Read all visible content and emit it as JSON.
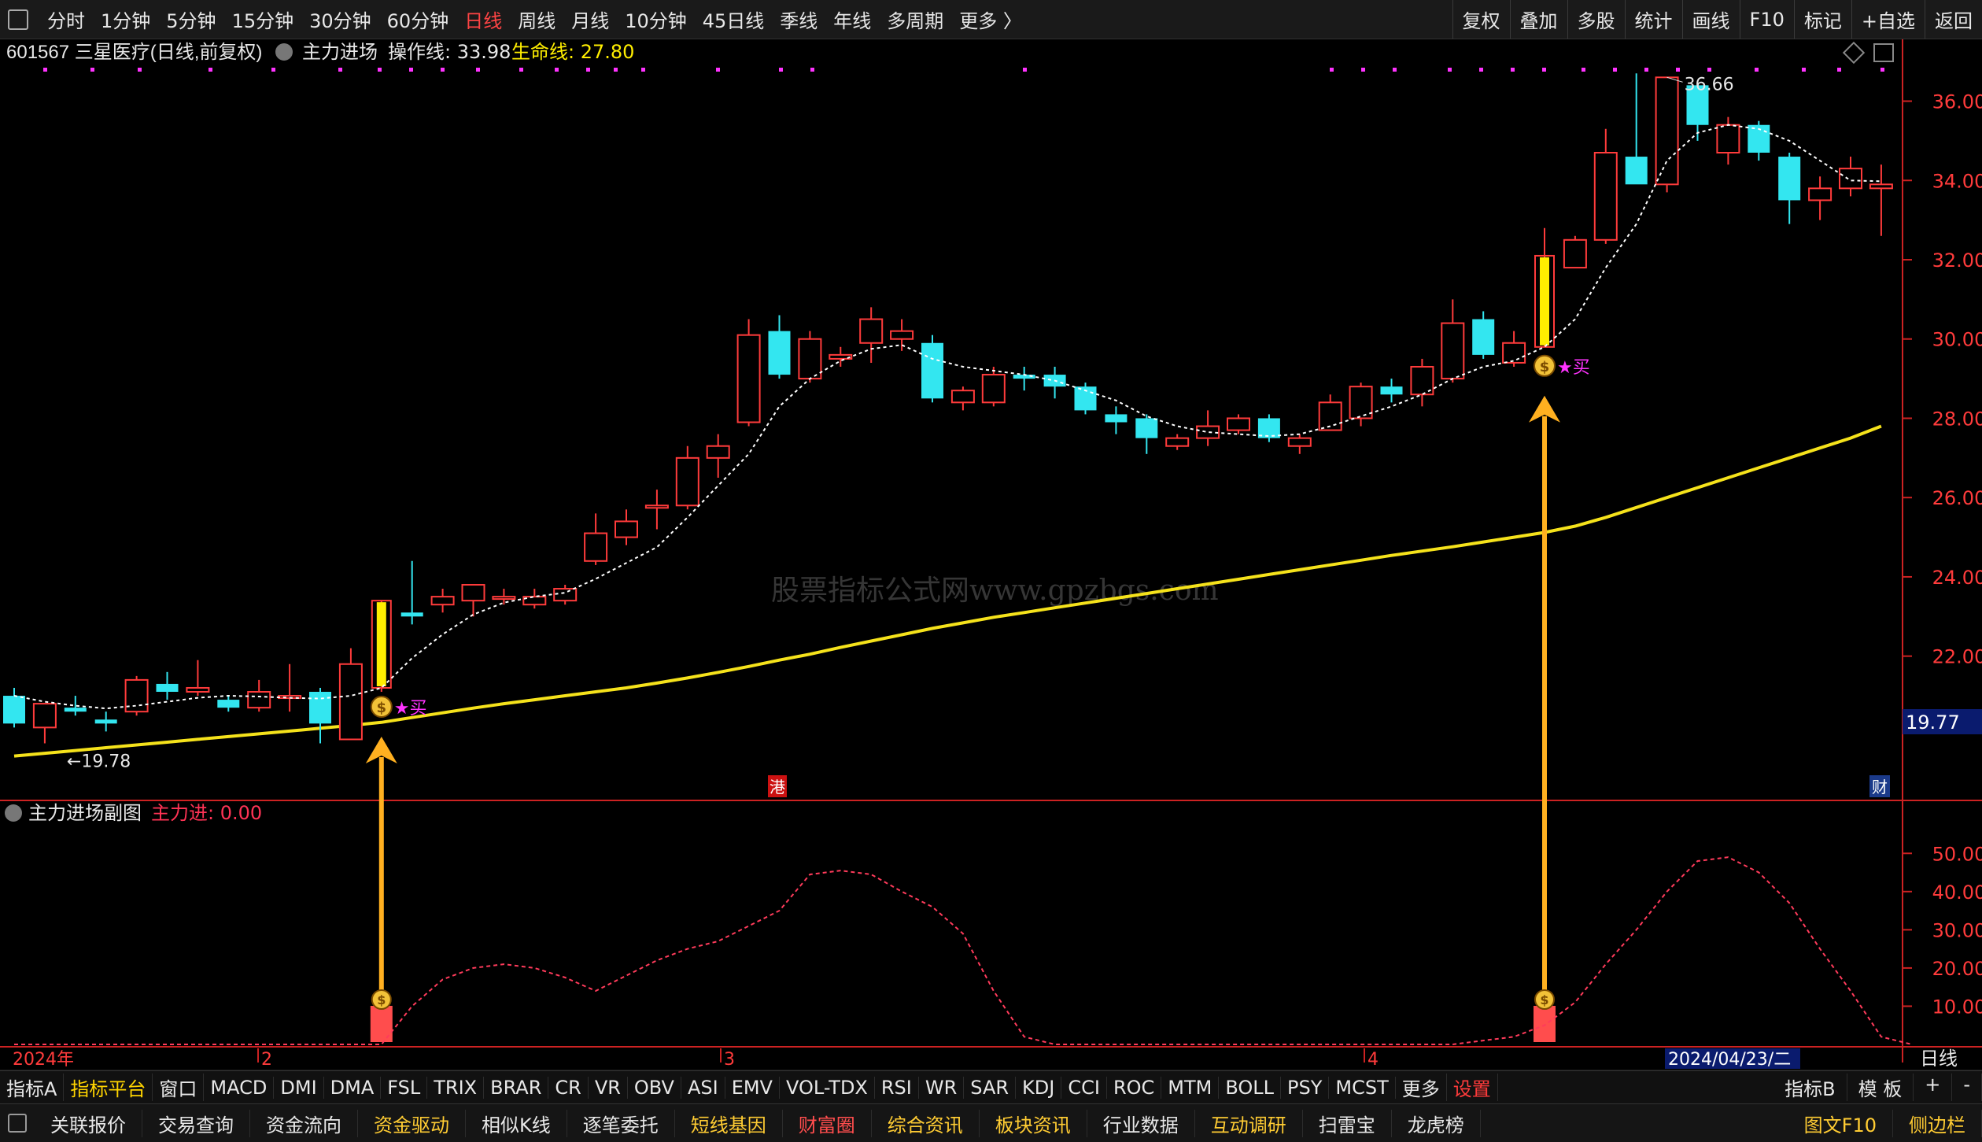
{
  "topbar": {
    "periods": [
      {
        "label": "分时",
        "active": false
      },
      {
        "label": "1分钟",
        "active": false
      },
      {
        "label": "5分钟",
        "active": false
      },
      {
        "label": "15分钟",
        "active": false
      },
      {
        "label": "30分钟",
        "active": false
      },
      {
        "label": "60分钟",
        "active": false
      },
      {
        "label": "日线",
        "active": true
      },
      {
        "label": "周线",
        "active": false
      },
      {
        "label": "月线",
        "active": false
      },
      {
        "label": "10分钟",
        "active": false
      },
      {
        "label": "45日线",
        "active": false
      },
      {
        "label": "季线",
        "active": false
      },
      {
        "label": "年线",
        "active": false
      },
      {
        "label": "多周期",
        "active": false
      },
      {
        "label": "更多 〉",
        "active": false
      }
    ],
    "right_buttons": [
      "复权",
      "叠加",
      "多股",
      "统计",
      "画线",
      "F10",
      "标记",
      "+自选",
      "返回"
    ]
  },
  "main_panel": {
    "stock_label": "601567 三星医疗(日线,前复权)",
    "indicator_name": "主力进场",
    "op_line_label": "操作线: 33.98",
    "life_line_label": "生命线: 27.80",
    "watermark": "股票指标公式网www.gpzbgs.com",
    "price_tag": "19.77",
    "low_label": "←19.78",
    "high_label": "36.66",
    "badge_gang": "港",
    "badge_cai": "财",
    "buy_label": "★买",
    "colors": {
      "up": "#ff3b3b",
      "down": "#33e6f0",
      "signal": "#ffee00",
      "life": "#f5e21b",
      "axis": "#cc2222",
      "arrow": "#ffb020",
      "magenta": "#ff33ff"
    }
  },
  "sub_panel": {
    "title": "主力进场副图",
    "value_label": "主力进: 0.00"
  },
  "x_labels": {
    "year": "2024年",
    "m2": "2",
    "m3": "3",
    "m4": "4",
    "cursor_date": "2024/04/23/二",
    "period": "日线"
  },
  "bottom_tabs": [
    "指标A",
    "指标平台",
    "窗口",
    "MACD",
    "DMI",
    "DMA",
    "FSL",
    "TRIX",
    "BRAR",
    "CR",
    "VR",
    "OBV",
    "ASI",
    "EMV",
    "VOL-TDX",
    "RSI",
    "WR",
    "SAR",
    "KDJ",
    "CCI",
    "ROC",
    "MTM",
    "BOLL",
    "PSY",
    "MCST",
    "更多",
    "设置"
  ],
  "bottom_right_tabs": [
    "指标B",
    "模 板",
    "+",
    "-"
  ],
  "bottom_buttons": [
    {
      "label": "关联报价",
      "style": ""
    },
    {
      "label": "交易查询",
      "style": ""
    },
    {
      "label": "资金流向",
      "style": ""
    },
    {
      "label": "资金驱动",
      "style": "y"
    },
    {
      "label": "相似K线",
      "style": ""
    },
    {
      "label": "逐笔委托",
      "style": ""
    },
    {
      "label": "短线基因",
      "style": "y"
    },
    {
      "label": "财富圈",
      "style": "r"
    },
    {
      "label": "综合资讯",
      "style": "y"
    },
    {
      "label": "板块资讯",
      "style": "y"
    },
    {
      "label": "行业数据",
      "style": ""
    },
    {
      "label": "互动调研",
      "style": "y"
    },
    {
      "label": "扫雷宝",
      "style": ""
    },
    {
      "label": "龙虎榜",
      "style": ""
    }
  ],
  "bottom_right_buttons": [
    "图文F10",
    "侧边栏"
  ],
  "chart_data": {
    "type": "candlestick",
    "y_axis": {
      "ticks": [
        "36.00",
        "34.00",
        "32.00",
        "30.00",
        "28.00",
        "26.00",
        "24.00",
        "22.00"
      ],
      "ylim": [
        18.4,
        37.4
      ]
    },
    "sub_y_axis": {
      "ticks": [
        "50.00",
        "40.00",
        "30.00",
        "20.00",
        "10.00"
      ],
      "ylim": [
        0,
        55
      ]
    },
    "candles": [
      {
        "o": 21.0,
        "h": 21.2,
        "l": 20.2,
        "c": 20.3
      },
      {
        "o": 20.2,
        "h": 20.8,
        "l": 19.8,
        "c": 20.8
      },
      {
        "o": 20.7,
        "h": 21.0,
        "l": 20.5,
        "c": 20.6
      },
      {
        "o": 20.4,
        "h": 20.6,
        "l": 20.1,
        "c": 20.3
      },
      {
        "o": 20.6,
        "h": 21.5,
        "l": 20.5,
        "c": 21.4
      },
      {
        "o": 21.3,
        "h": 21.6,
        "l": 20.9,
        "c": 21.1
      },
      {
        "o": 21.1,
        "h": 21.9,
        "l": 21.0,
        "c": 21.2
      },
      {
        "o": 20.9,
        "h": 21.0,
        "l": 20.6,
        "c": 20.7
      },
      {
        "o": 20.7,
        "h": 21.4,
        "l": 20.6,
        "c": 21.1
      },
      {
        "o": 21.0,
        "h": 21.8,
        "l": 20.6,
        "c": 21.0
      },
      {
        "o": 21.1,
        "h": 21.2,
        "l": 19.8,
        "c": 20.3
      },
      {
        "o": 19.9,
        "h": 22.2,
        "l": 19.9,
        "c": 21.8
      },
      {
        "o": 21.2,
        "h": 23.4,
        "l": 21.1,
        "c": 23.4,
        "signal": true
      },
      {
        "o": 23.1,
        "h": 24.4,
        "l": 22.8,
        "c": 23.0
      },
      {
        "o": 23.3,
        "h": 23.7,
        "l": 23.1,
        "c": 23.5
      },
      {
        "o": 23.4,
        "h": 23.8,
        "l": 23.0,
        "c": 23.8
      },
      {
        "o": 23.5,
        "h": 23.7,
        "l": 23.3,
        "c": 23.5
      },
      {
        "o": 23.3,
        "h": 23.7,
        "l": 23.2,
        "c": 23.5
      },
      {
        "o": 23.4,
        "h": 23.8,
        "l": 23.3,
        "c": 23.7
      },
      {
        "o": 24.4,
        "h": 25.6,
        "l": 24.3,
        "c": 25.1
      },
      {
        "o": 25.0,
        "h": 25.7,
        "l": 24.8,
        "c": 25.4
      },
      {
        "o": 25.8,
        "h": 26.2,
        "l": 25.2,
        "c": 25.8
      },
      {
        "o": 25.8,
        "h": 27.3,
        "l": 25.7,
        "c": 27.0
      },
      {
        "o": 27.0,
        "h": 27.6,
        "l": 26.5,
        "c": 27.3
      },
      {
        "o": 27.9,
        "h": 30.5,
        "l": 27.8,
        "c": 30.1
      },
      {
        "o": 30.2,
        "h": 30.6,
        "l": 29.0,
        "c": 29.1
      },
      {
        "o": 29.0,
        "h": 30.2,
        "l": 28.9,
        "c": 30.0
      },
      {
        "o": 29.5,
        "h": 29.8,
        "l": 29.3,
        "c": 29.6
      },
      {
        "o": 29.9,
        "h": 30.8,
        "l": 29.4,
        "c": 30.5
      },
      {
        "o": 30.0,
        "h": 30.5,
        "l": 29.7,
        "c": 30.2
      },
      {
        "o": 29.9,
        "h": 30.1,
        "l": 28.4,
        "c": 28.5
      },
      {
        "o": 28.4,
        "h": 28.8,
        "l": 28.2,
        "c": 28.7
      },
      {
        "o": 28.4,
        "h": 29.3,
        "l": 28.3,
        "c": 29.1
      },
      {
        "o": 29.1,
        "h": 29.3,
        "l": 28.7,
        "c": 29.0
      },
      {
        "o": 29.1,
        "h": 29.3,
        "l": 28.5,
        "c": 28.8
      },
      {
        "o": 28.8,
        "h": 28.9,
        "l": 28.1,
        "c": 28.2
      },
      {
        "o": 28.1,
        "h": 28.3,
        "l": 27.6,
        "c": 27.9
      },
      {
        "o": 28.0,
        "h": 28.1,
        "l": 27.1,
        "c": 27.5
      },
      {
        "o": 27.3,
        "h": 27.6,
        "l": 27.2,
        "c": 27.5
      },
      {
        "o": 27.5,
        "h": 28.2,
        "l": 27.3,
        "c": 27.8
      },
      {
        "o": 27.7,
        "h": 28.1,
        "l": 27.6,
        "c": 28.0
      },
      {
        "o": 28.0,
        "h": 28.1,
        "l": 27.4,
        "c": 27.5
      },
      {
        "o": 27.3,
        "h": 27.6,
        "l": 27.1,
        "c": 27.5
      },
      {
        "o": 27.7,
        "h": 28.6,
        "l": 27.7,
        "c": 28.4
      },
      {
        "o": 28.0,
        "h": 28.9,
        "l": 27.8,
        "c": 28.8
      },
      {
        "o": 28.8,
        "h": 29.0,
        "l": 28.4,
        "c": 28.6
      },
      {
        "o": 28.6,
        "h": 29.5,
        "l": 28.3,
        "c": 29.3
      },
      {
        "o": 29.0,
        "h": 31.0,
        "l": 28.9,
        "c": 30.4
      },
      {
        "o": 30.5,
        "h": 30.7,
        "l": 29.5,
        "c": 29.6
      },
      {
        "o": 29.4,
        "h": 30.2,
        "l": 29.3,
        "c": 29.9
      },
      {
        "o": 29.8,
        "h": 32.8,
        "l": 29.8,
        "c": 32.1,
        "signal": true
      },
      {
        "o": 31.8,
        "h": 32.6,
        "l": 31.8,
        "c": 32.5
      },
      {
        "o": 32.5,
        "h": 35.3,
        "l": 32.4,
        "c": 34.7
      },
      {
        "o": 34.6,
        "h": 36.7,
        "l": 34.1,
        "c": 33.9
      },
      {
        "o": 33.9,
        "h": 36.6,
        "l": 33.7,
        "c": 36.6
      },
      {
        "o": 36.4,
        "h": 36.5,
        "l": 35.0,
        "c": 35.4
      },
      {
        "o": 34.7,
        "h": 35.6,
        "l": 34.4,
        "c": 35.4
      },
      {
        "o": 35.4,
        "h": 35.5,
        "l": 34.5,
        "c": 34.7
      },
      {
        "o": 34.6,
        "h": 34.7,
        "l": 32.9,
        "c": 33.5
      },
      {
        "o": 33.5,
        "h": 34.1,
        "l": 33.0,
        "c": 33.8
      },
      {
        "o": 33.8,
        "h": 34.6,
        "l": 33.6,
        "c": 34.3
      },
      {
        "o": 33.8,
        "h": 34.4,
        "l": 32.6,
        "c": 33.9
      }
    ],
    "op_line": [
      21.0,
      20.85,
      20.75,
      20.68,
      20.75,
      20.85,
      20.95,
      21.0,
      20.98,
      20.95,
      20.93,
      21.0,
      21.2,
      21.95,
      22.55,
      23.05,
      23.35,
      23.5,
      23.6,
      23.95,
      24.35,
      24.75,
      25.5,
      26.3,
      27.1,
      28.3,
      29.0,
      29.45,
      29.75,
      29.85,
      29.5,
      29.3,
      29.2,
      29.1,
      28.95,
      28.7,
      28.45,
      28.05,
      27.8,
      27.65,
      27.6,
      27.55,
      27.6,
      27.8,
      28.05,
      28.3,
      28.6,
      29.0,
      29.3,
      29.45,
      29.8,
      30.5,
      31.8,
      32.9,
      34.5,
      35.2,
      35.4,
      35.3,
      35.0,
      34.5,
      34.0,
      33.98
    ],
    "life_line": [
      19.48,
      19.55,
      19.62,
      19.69,
      19.76,
      19.83,
      19.9,
      19.97,
      20.04,
      20.11,
      20.18,
      20.25,
      20.33,
      20.45,
      20.57,
      20.69,
      20.8,
      20.9,
      21.0,
      21.1,
      21.2,
      21.32,
      21.45,
      21.59,
      21.74,
      21.9,
      22.05,
      22.22,
      22.38,
      22.54,
      22.7,
      22.84,
      22.98,
      23.1,
      23.22,
      23.34,
      23.46,
      23.58,
      23.7,
      23.82,
      23.94,
      24.06,
      24.18,
      24.3,
      24.42,
      24.54,
      24.65,
      24.76,
      24.88,
      25.0,
      25.12,
      25.28,
      25.5,
      25.75,
      26.0,
      26.25,
      26.5,
      26.75,
      27.0,
      27.25,
      27.5,
      27.8
    ],
    "sub_series": {
      "name": "主力进",
      "values": [
        0,
        0,
        0,
        0,
        0,
        0,
        0,
        0,
        0,
        0,
        0,
        0,
        0,
        10,
        17,
        20,
        21,
        20,
        17.5,
        14,
        18,
        22,
        25,
        27,
        31,
        35,
        44.5,
        45.5,
        44.5,
        40,
        36,
        29,
        14,
        2,
        0,
        0,
        0,
        0,
        0,
        0,
        0,
        0,
        0,
        0,
        0,
        0,
        0,
        0,
        1,
        2,
        5,
        11,
        21,
        30,
        40,
        48,
        49,
        45,
        37,
        25,
        14,
        2,
        0
      ]
    },
    "signal_candles": [
      12,
      50
    ],
    "low_index": 1,
    "high_index": 54
  }
}
